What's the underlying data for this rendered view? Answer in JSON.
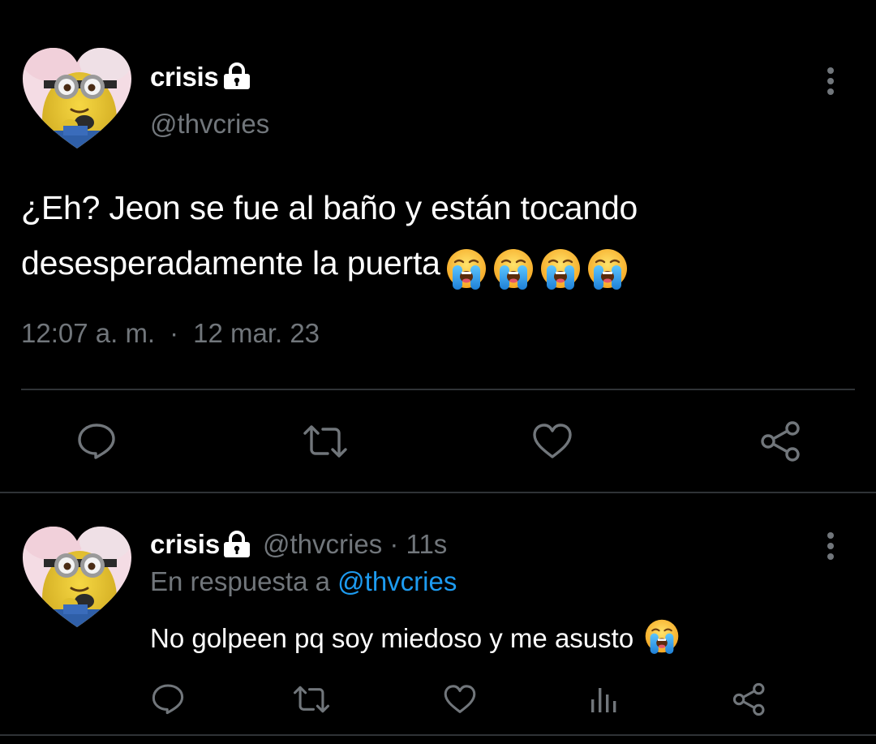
{
  "main_tweet": {
    "display_name": "crisis",
    "handle": "@thvcries",
    "text": "¿Eh? Jeon se fue al baño y están tocando desesperadamente la puerta",
    "emojis": [
      "loudly-crying-face",
      "loudly-crying-face",
      "loudly-crying-face",
      "loudly-crying-face"
    ],
    "time": "12:07 a. m.",
    "separator": "·",
    "date": "12 mar. 23",
    "actions": [
      "reply-icon",
      "retweet-icon",
      "like-icon",
      "share-icon"
    ]
  },
  "reply": {
    "display_name": "crisis",
    "handle": "@thvcries",
    "separator": "·",
    "time_ago": "11s",
    "reply_prefix": "En respuesta a",
    "reply_mention": "@thvcries",
    "text": "No golpeen pq soy miedoso y me asusto",
    "emojis": [
      "loudly-crying-face"
    ],
    "actions": [
      "reply-icon",
      "retweet-icon",
      "like-icon",
      "analytics-icon",
      "share-icon"
    ]
  },
  "colors": {
    "background": "#000000",
    "text_primary": "#ffffff",
    "text_secondary": "#71767b",
    "link": "#1d9bf0",
    "divider": "#2f3336",
    "icon": "#71767b"
  }
}
